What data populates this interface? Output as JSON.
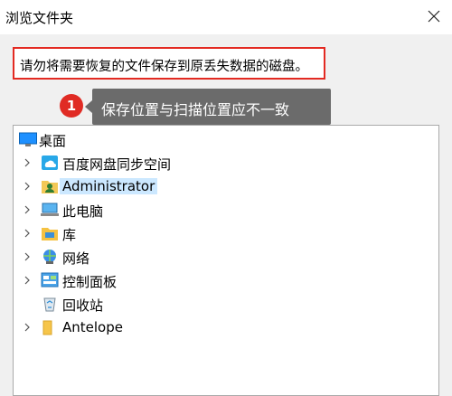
{
  "window": {
    "title": "浏览文件夹"
  },
  "notice": {
    "text": "请勿将需要恢复的文件保存到原丢失数据的磁盘。"
  },
  "callout": {
    "number": "1",
    "text": "保存位置与扫描位置应不一致"
  },
  "tree": {
    "root": {
      "label": "桌面",
      "icon": "desktop-icon"
    },
    "items": [
      {
        "label": "百度网盘同步空间",
        "icon": "cloud-folder-icon",
        "expandable": true
      },
      {
        "label": "Administrator",
        "icon": "user-folder-icon",
        "expandable": true,
        "selected": true
      },
      {
        "label": "此电脑",
        "icon": "computer-icon",
        "expandable": true
      },
      {
        "label": "库",
        "icon": "library-icon",
        "expandable": true
      },
      {
        "label": "网络",
        "icon": "network-icon",
        "expandable": true
      },
      {
        "label": "控制面板",
        "icon": "control-panel-icon",
        "expandable": true
      },
      {
        "label": "回收站",
        "icon": "recycle-bin-icon",
        "expandable": false
      },
      {
        "label": "Antelope",
        "icon": "folder-icon",
        "expandable": true
      }
    ]
  },
  "colors": {
    "highlight_border": "#e32a22",
    "badge": "#e02b24",
    "tooltip_bg": "#6b6b6b",
    "selection": "#cce8ff"
  }
}
